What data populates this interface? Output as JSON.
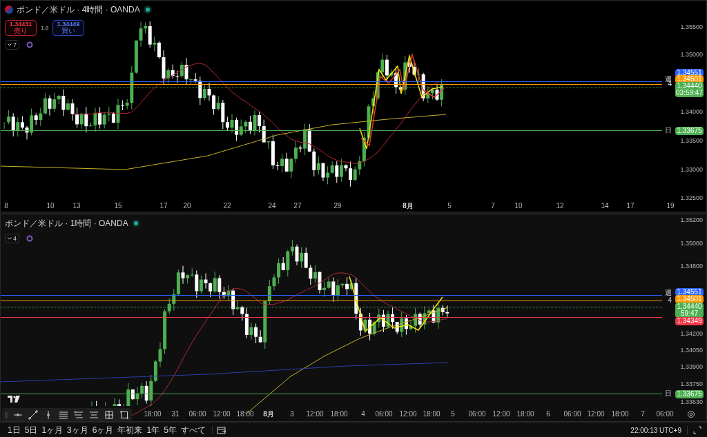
{
  "panes": [
    {
      "title": "ポンド／米ドル · 4時間 · OANDA",
      "trade": {
        "sell_price": "1.34431",
        "sell_label": "売り",
        "spread": "1.8",
        "buy_price": "1.34449",
        "buy_label": "買い"
      },
      "indicators_count": "7",
      "price_ticks": [
        "1.35500",
        "1.35000",
        "1.34000",
        "1.33500",
        "1.33000",
        "1.32500"
      ],
      "time_ticks": [
        {
          "label": "8",
          "bold": false
        },
        {
          "label": "10",
          "bold": false
        },
        {
          "label": "13",
          "bold": false
        },
        {
          "label": "15",
          "bold": false
        },
        {
          "label": "17",
          "bold": false
        },
        {
          "label": "20",
          "bold": false
        },
        {
          "label": "22",
          "bold": false
        },
        {
          "label": "24",
          "bold": false
        },
        {
          "label": "27",
          "bold": false
        },
        {
          "label": "29",
          "bold": false
        },
        {
          "label": "8月",
          "bold": true
        },
        {
          "label": "5",
          "bold": false
        },
        {
          "label": "7",
          "bold": false
        },
        {
          "label": "10",
          "bold": false
        },
        {
          "label": "12",
          "bold": false
        },
        {
          "label": "14",
          "bold": false
        },
        {
          "label": "17",
          "bold": false
        },
        {
          "label": "19",
          "bold": false
        }
      ],
      "price_tags": [
        {
          "kind": "level",
          "price": "1.34551",
          "color": "#2962ff",
          "line_label": "週"
        },
        {
          "kind": "level",
          "price": "1.34501",
          "color": "#ff9800",
          "line_label": "4"
        },
        {
          "kind": "current",
          "price": "1.34440",
          "countdown": "03:59:47",
          "color": "#4caf50"
        },
        {
          "kind": "level",
          "price": "1.33675",
          "color": "#4caf50",
          "line_label": "日"
        }
      ]
    },
    {
      "title": "ポンド／米ドル · 1時間 · OANDA",
      "indicators_count": "4",
      "price_ticks": [
        "1.35200",
        "1.35000",
        "1.34800",
        "1.34200",
        "1.34050",
        "1.33900",
        "1.33750",
        "1.33630"
      ],
      "time_ticks": [
        {
          "label": "18:00",
          "bold": false
        },
        {
          "label": "31",
          "bold": false
        },
        {
          "label": "06:00",
          "bold": false
        },
        {
          "label": "12:00",
          "bold": false
        },
        {
          "label": "18:00",
          "bold": false
        },
        {
          "label": "8月",
          "bold": true
        },
        {
          "label": "3",
          "bold": false
        },
        {
          "label": "12:00",
          "bold": false
        },
        {
          "label": "18:00",
          "bold": false
        },
        {
          "label": "4",
          "bold": false
        },
        {
          "label": "06:00",
          "bold": false
        },
        {
          "label": "12:00",
          "bold": false
        },
        {
          "label": "18:00",
          "bold": false
        },
        {
          "label": "5",
          "bold": false
        },
        {
          "label": "06:00",
          "bold": false
        },
        {
          "label": "12:00",
          "bold": false
        },
        {
          "label": "18:00",
          "bold": false
        },
        {
          "label": "6",
          "bold": false
        },
        {
          "label": "06:00",
          "bold": false
        },
        {
          "label": "12:00",
          "bold": false
        },
        {
          "label": "18:00",
          "bold": false
        },
        {
          "label": "7",
          "bold": false
        },
        {
          "label": "06:00",
          "bold": false
        }
      ],
      "price_tags": [
        {
          "kind": "level",
          "price": "1.34551",
          "color": "#2962ff",
          "line_label": "週"
        },
        {
          "kind": "level",
          "price": "1.34501",
          "color": "#ff9800",
          "line_label": "4"
        },
        {
          "kind": "current",
          "price": "1.34440",
          "countdown": "59:47",
          "color": "#4caf50"
        },
        {
          "kind": "level",
          "price": "1.34349",
          "color": "#f23645"
        },
        {
          "kind": "level",
          "price": "1.33675",
          "color": "#4caf50",
          "line_label": "日"
        }
      ]
    }
  ],
  "bottom_bar": {
    "ranges": [
      "1日",
      "5日",
      "1ヶ月",
      "3ヶ月",
      "6ヶ月",
      "年初来",
      "1年",
      "5年",
      "すべて"
    ],
    "time": "22:00:13 UTC+9"
  }
}
